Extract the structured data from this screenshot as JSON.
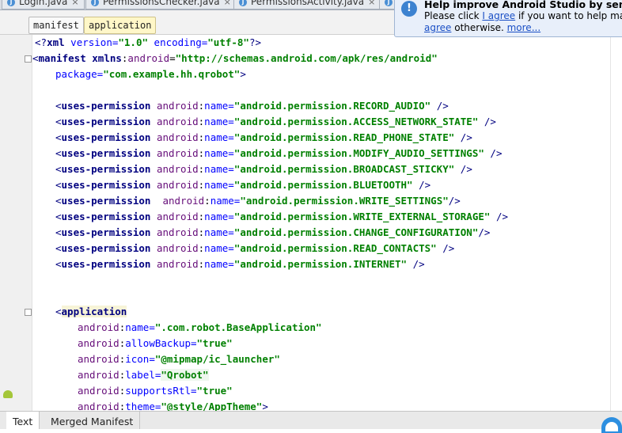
{
  "file_tabs": [
    {
      "label": "Login.java"
    },
    {
      "label": "PermissionsChecker.java"
    },
    {
      "label": "PermissionsActivity.java"
    }
  ],
  "breadcrumb": [
    "manifest",
    "application"
  ],
  "code_lines": [
    [
      "<?",
      "xml",
      " version=",
      "\"1.0\"",
      " encoding=",
      "\"utf-8\"",
      "?>"
    ],
    [
      "manifest xmlns",
      "android",
      "\"http://schemas.android.com/apk/res/android\""
    ],
    [
      "package=",
      "\"com.example.hh.qrobot\"",
      ">"
    ],
    [],
    [
      "uses-permission",
      "android",
      "name=",
      "\"android.permission.RECORD_AUDIO\"",
      " />"
    ],
    [
      "uses-permission",
      "android",
      "name=",
      "\"android.permission.ACCESS_NETWORK_STATE\"",
      " />"
    ],
    [
      "uses-permission",
      "android",
      "name=",
      "\"android.permission.READ_PHONE_STATE\"",
      " />"
    ],
    [
      "uses-permission",
      "android",
      "name=",
      "\"android.permission.MODIFY_AUDIO_SETTINGS\"",
      " />"
    ],
    [
      "uses-permission",
      "android",
      "name=",
      "\"android.permission.BROADCAST_STICKY\"",
      " />"
    ],
    [
      "uses-permission",
      "android",
      "name=",
      "\"android.permission.BLUETOOTH\"",
      " />"
    ],
    [
      "uses-permission",
      "android",
      "name=",
      "\"android.permission.WRITE_SETTINGS\"",
      "/>"
    ],
    [
      "uses-permission",
      "android",
      "name=",
      "\"android.permission.WRITE_EXTERNAL_STORAGE\"",
      " />"
    ],
    [
      "uses-permission",
      "android",
      "name=",
      "\"android.permission.CHANGE_CONFIGURATION\"",
      "/>"
    ],
    [
      "uses-permission",
      "android",
      "name=",
      "\"android.permission.READ_CONTACTS\"",
      " />"
    ],
    [
      "uses-permission",
      "android",
      "name=",
      "\"android.permission.INTERNET\"",
      " />"
    ],
    [],
    [],
    [
      "application"
    ],
    [
      "android",
      "name=",
      "\".com.robot.BaseApplication\""
    ],
    [
      "android",
      "allowBackup=",
      "\"true\""
    ],
    [
      "android",
      "icon=",
      "\"@mipmap/ic_launcher\""
    ],
    [
      "android",
      "label=",
      "\"Qrobot\""
    ],
    [
      "android",
      "supportsRtl=",
      "\"true\""
    ],
    [
      "android",
      "theme=",
      "\"@style/AppTheme\"",
      ">"
    ]
  ],
  "notification": {
    "title": "Help improve Android Studio by sending",
    "line1_pre": "Please click ",
    "line1_link": "I agree",
    "line1_post": " if you want to help make A",
    "line2_link1": "agree",
    "line2_mid": " otherwise. ",
    "line2_link2": "more..."
  },
  "bottom_tabs": [
    {
      "label": "Text",
      "active": true
    },
    {
      "label": "Merged Manifest",
      "active": false
    }
  ],
  "icons": {
    "info": "info-icon",
    "android": "android-icon",
    "java_file": "java-file-icon",
    "mascot": "assistant-mascot-icon"
  }
}
